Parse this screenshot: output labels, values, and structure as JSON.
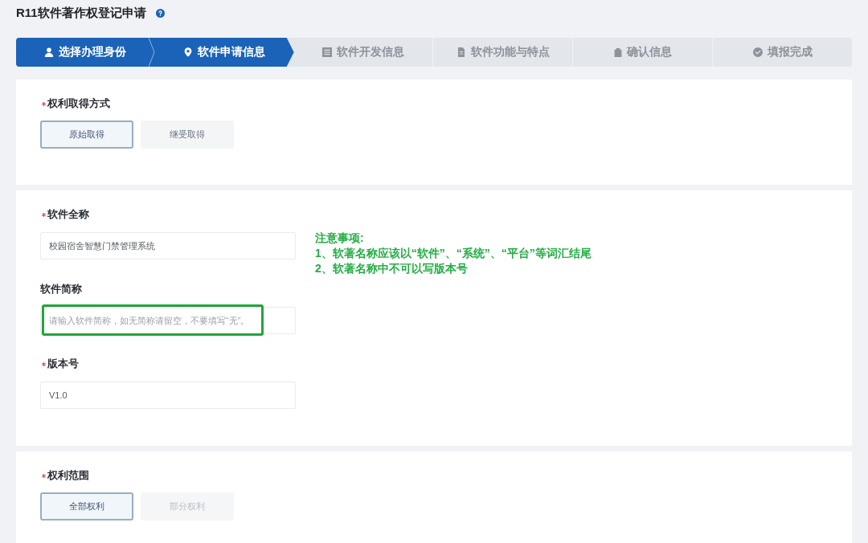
{
  "page": {
    "title": "R11软件著作权登记申请"
  },
  "steps": [
    {
      "label": "选择办理身份",
      "done": true,
      "selected": false
    },
    {
      "label": "软件申请信息",
      "done": false,
      "selected": true
    },
    {
      "label": "软件开发信息",
      "done": false,
      "selected": false
    },
    {
      "label": "软件功能与特点",
      "done": false,
      "selected": false
    },
    {
      "label": "确认信息",
      "done": false,
      "selected": false
    },
    {
      "label": "填报完成",
      "done": false,
      "selected": false
    }
  ],
  "sections": [
    {
      "kind": "choice",
      "label": "权利取得方式",
      "required": true,
      "options": [
        {
          "label": "原始取得",
          "selected": true,
          "disabled": false
        },
        {
          "label": "继受取得",
          "selected": false,
          "disabled": false
        }
      ]
    },
    {
      "kind": "form",
      "fields": [
        {
          "label": "软件全称",
          "required": true,
          "value": "校园宿舍智慧门禁管理系统",
          "highlighted": false
        },
        {
          "label": "软件简称",
          "required": false,
          "placeholder": "请输入软件简称，如无简称请留空，不要填写“无”。",
          "highlighted": true
        },
        {
          "label": "版本号",
          "required": true,
          "value": "V1.0",
          "highlighted": false
        }
      ],
      "notice": {
        "title": "注意事项:",
        "lines": [
          "1、软著名称应该以“软件”、“系统”、“平台”等词汇结尾",
          "2、软著名称中不可以写版本号"
        ]
      }
    },
    {
      "kind": "choice",
      "label": "权利范围",
      "required": true,
      "options": [
        {
          "label": "全部权利",
          "selected": true,
          "disabled": false
        },
        {
          "label": "部分权利",
          "selected": false,
          "disabled": true
        }
      ]
    }
  ]
}
